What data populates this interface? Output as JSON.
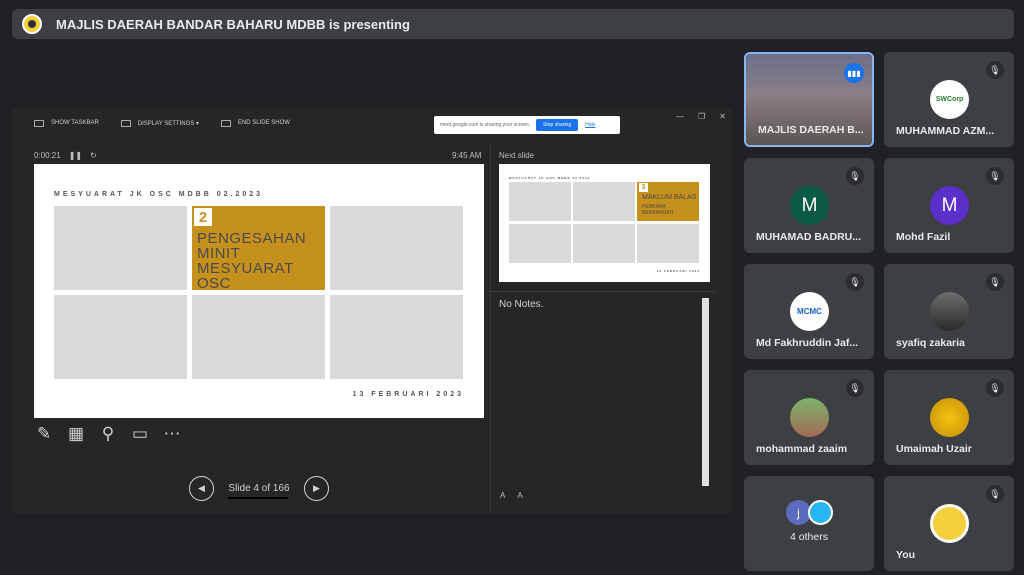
{
  "meeting": {
    "presenting_title": "MAJLIS DAERAH BANDAR BAHARU MDBB is presenting"
  },
  "presentation": {
    "toolbar": {
      "show_taskbar": "SHOW TASKBAR",
      "display_settings": "DISPLAY SETTINGS ▾",
      "end_slide_show": "END SLIDE SHOW"
    },
    "share_banner": {
      "text": "meet.google.com is sharing your screen.",
      "stop": "Stop sharing",
      "hide": "Hide"
    },
    "timer": "0:00:21",
    "clock": "9:45 AM",
    "next_slide_label": "Next slide",
    "current_slide": {
      "title": "MESYUARAT JK OSC MDBB 02.2023",
      "number": "2",
      "heading_line1": "PENGESAHAN",
      "heading_line2": "MINIT MESYUARAT",
      "heading_line3": "OSC",
      "date": "13 FEBRUARI 2023"
    },
    "next_slide": {
      "title": "MESYUARAT JK OSC MDBB 02.2023",
      "number": "3",
      "heading_line1": "MAKLUM BALAS",
      "heading_line2": "PERKARA BERBANGKIT",
      "date": "13 FEBRUARI 2023"
    },
    "slide_counter": "Slide 4 of 166",
    "notes": "No Notes.",
    "font_controls": {
      "increase": "A",
      "decrease": "A"
    }
  },
  "participants": [
    {
      "name": "MAJLIS DAERAH B...",
      "speaking": true
    },
    {
      "name": "MUHAMMAD AZM...",
      "avatar": "SWCorp",
      "muted": true
    },
    {
      "name": "MUHAMAD BADRU...",
      "initial": "M",
      "color": "#0b5a44",
      "muted": true
    },
    {
      "name": "Mohd Fazil",
      "initial": "M",
      "color": "#5b2fc9",
      "muted": true
    },
    {
      "name": "Md Fakhruddin Jaf...",
      "avatar": "MCMC",
      "muted": true
    },
    {
      "name": "syafiq zakaria",
      "muted": true
    },
    {
      "name": "mohammad zaaim",
      "muted": true
    },
    {
      "name": "Umaimah Uzair",
      "muted": true
    },
    {
      "name": "4 others",
      "initial": "j"
    },
    {
      "name": "You",
      "muted": true
    }
  ]
}
